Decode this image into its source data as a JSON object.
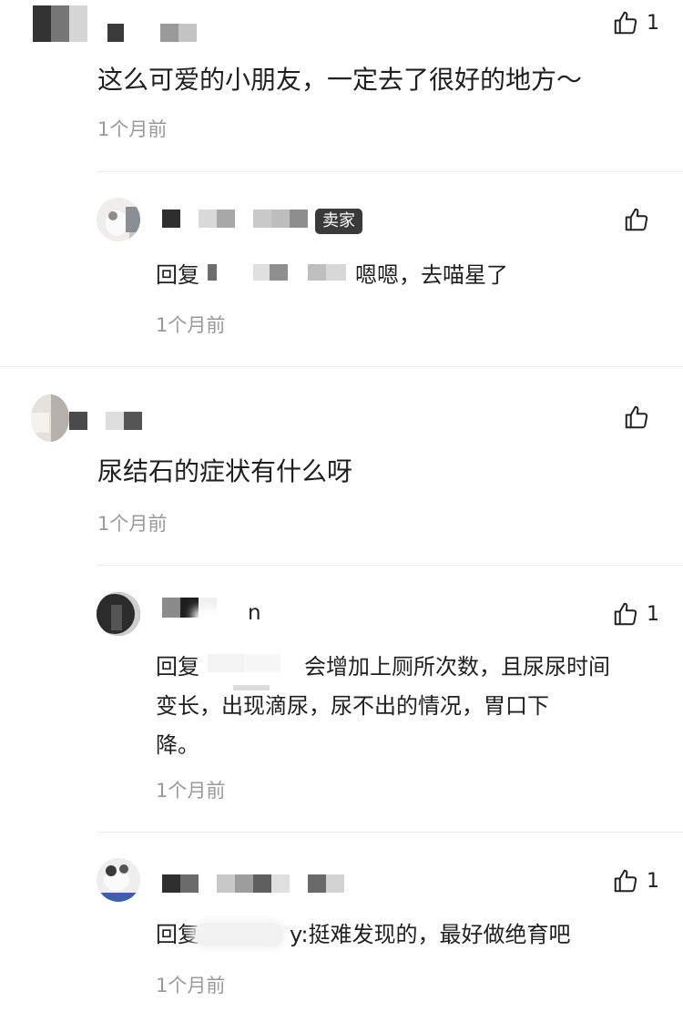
{
  "comments": [
    {
      "text": "这么可爱的小朋友，一定去了很好的地方～",
      "time": "1个月前",
      "likes": "1",
      "replies": [
        {
          "badge": "卖家",
          "reply_prefix": "回复",
          "reply_text": "嗯嗯，去喵星了",
          "time": "1个月前",
          "likes": ""
        }
      ]
    },
    {
      "text": "尿结石的症状有什么呀",
      "time": "1个月前",
      "likes": "",
      "replies": [
        {
          "name_tail": "n",
          "reply_prefix": "回复",
          "reply_line1": "会增加上厕所次数，且尿尿时间",
          "reply_line2": "变长，出现滴尿，尿不出的情况，胃口下",
          "reply_line3": "降。",
          "time": "1个月前",
          "likes": "1"
        },
        {
          "reply_prefix": "回复",
          "reply_text": "y:挺难发现的，最好做绝育吧",
          "time": "1个月前",
          "likes": "1"
        }
      ]
    }
  ],
  "icons": {
    "like": "thumbs-up-icon"
  },
  "colors": {
    "text": "#1f1f1f",
    "muted": "#9a9a9a",
    "badge_bg": "#3a3a3a",
    "divider": "#ececec"
  }
}
